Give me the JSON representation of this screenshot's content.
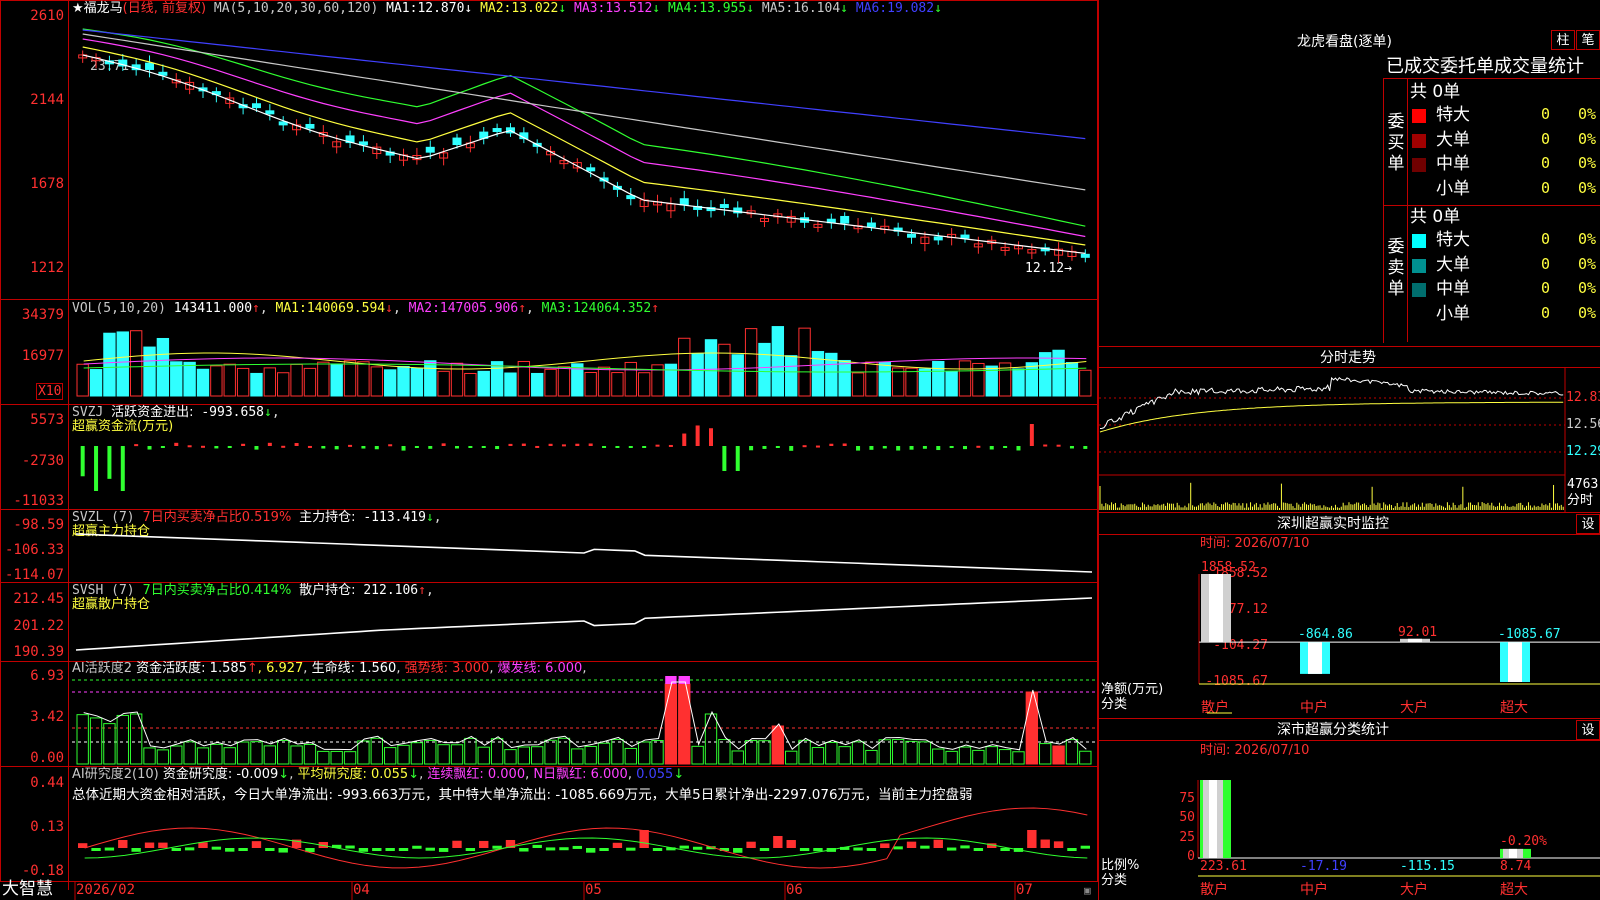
{
  "stock": {
    "star": "★",
    "name": "福龙马",
    "mode": "(日线, 前复权)",
    "ma_header": "MA(5,10,20,30,60,120)",
    "ma": [
      {
        "label": "MA1:",
        "value": "12.870",
        "arrow": "↓"
      },
      {
        "label": "MA2:",
        "value": "13.022",
        "arrow": "↓"
      },
      {
        "label": "MA3:",
        "value": "13.512",
        "arrow": "↓"
      },
      {
        "label": "MA4:",
        "value": "13.955",
        "arrow": "↓"
      },
      {
        "label": "MA5:",
        "value": "16.104",
        "arrow": "↓"
      },
      {
        "label": "MA6:",
        "value": "19.082",
        "arrow": "↓"
      }
    ],
    "high_marker": "23.71",
    "last_marker": "12.12→",
    "y_ticks": [
      "2610",
      "2144",
      "1678",
      "1212"
    ]
  },
  "vol": {
    "header": "VOL(5,10,20)",
    "value": "143411.000",
    "ma": [
      {
        "label": "MA1:",
        "value": "140069.594",
        "arrow": "↓"
      },
      {
        "label": "MA2:",
        "value": "147005.906",
        "arrow": "↑"
      },
      {
        "label": "MA3:",
        "value": "124064.352",
        "arrow": "↑"
      }
    ],
    "y_ticks": [
      "34379",
      "16977"
    ],
    "unit": "X10"
  },
  "svzj": {
    "name": "SVZJ",
    "title": "活跃资金进出:",
    "value": "-993.658",
    "arrow": "↓",
    "subtitle": "超赢资金流(万元)",
    "y_ticks": [
      "5573",
      "-2730",
      "-11033"
    ]
  },
  "svzl": {
    "name": "SVZL (7)",
    "ratio": "7日内买卖净占比0.519%",
    "label": "主力持仓:",
    "value": "-113.419",
    "arrow": "↓",
    "subtitle": "超赢主力持仓",
    "y_ticks": [
      "-98.59",
      "-106.33",
      "-114.07"
    ]
  },
  "svsh": {
    "name": "SVSH (7)",
    "ratio": "7日内买卖净占比0.414%",
    "label": "散户持仓:",
    "value": "212.106",
    "arrow": "↑",
    "subtitle": "超赢散户持仓",
    "y_ticks": [
      "212.45",
      "201.22",
      "190.39"
    ]
  },
  "ai_active": {
    "name": "AI活跃度2",
    "label": "资金活跃度:",
    "value": "1.585",
    "arrow": "↑",
    "value2": "6.927",
    "life_label": "生命线:",
    "life": "1.560",
    "strong": "强势线: 3.000",
    "burst": "爆发线: 6.000",
    "y_ticks": [
      "6.93",
      "3.42",
      "0.00"
    ]
  },
  "ai_research": {
    "name": "AI研究度2(10)",
    "label": "资金研究度:",
    "value": "-0.009",
    "arrow": "↓",
    "avg": "平均研究度: 0.055",
    "avg_arrow": "↓",
    "streak": "连续飘红: 0.000",
    "nday": "N日飘红: 6.000",
    "last": "0.055",
    "summary": "总体近期大资金相对活跃，今日大单净流出: -993.663万元，其中特大单净流出: -1085.669万元，大单5日累计净出-2297.076万元，当前主力控盘弱",
    "y_ticks": [
      "0.44",
      "0.13",
      "-0.18"
    ]
  },
  "footer": {
    "brand": "大智慧",
    "dates": [
      "2026/02",
      "04",
      "05",
      "06",
      "07"
    ]
  },
  "dragon": {
    "title": "龙虎看盘(逐单)",
    "btn1": "柱",
    "btn2": "笔",
    "subtitle": "已成交委托单成交量统计",
    "buy_label": [
      "委",
      "买",
      "单"
    ],
    "sell_label": [
      "委",
      "卖",
      "单"
    ],
    "buy_total": "共 0单",
    "sell_total": "共 0单",
    "buy_rows": [
      {
        "name": "特大",
        "count": "0",
        "pct": "0%",
        "color": "#ff0000"
      },
      {
        "name": "大单",
        "count": "0",
        "pct": "0%",
        "color": "#a00000"
      },
      {
        "name": "中单",
        "count": "0",
        "pct": "0%",
        "color": "#700000"
      },
      {
        "name": "小单",
        "count": "0",
        "pct": "0%",
        "color": "#000000"
      }
    ],
    "sell_rows": [
      {
        "name": "特大",
        "count": "0",
        "pct": "0%",
        "color": "#00ffff"
      },
      {
        "name": "大单",
        "count": "0",
        "pct": "0%",
        "color": "#009090"
      },
      {
        "name": "中单",
        "count": "0",
        "pct": "0%",
        "color": "#006e6e"
      },
      {
        "name": "小单",
        "count": "0",
        "pct": "0%",
        "color": "#000000"
      }
    ]
  },
  "intraday": {
    "title": "分时走势",
    "prices": [
      "12.83",
      "12.56",
      "12.29"
    ],
    "vol": "4763",
    "vol_label": "分时"
  },
  "monitor": {
    "title": "深圳超赢实时监控",
    "btn": "设",
    "time": "时间: 2026/07/10",
    "y_ticks": [
      "1858.52",
      "877.12",
      "-104.27",
      "-1085.67"
    ],
    "ylabel": "净额(万元)",
    "xlabel": "分类",
    "categories": [
      "散户",
      "中户",
      "大户",
      "超大"
    ],
    "values": [
      1858.52,
      -864.86,
      92.01,
      -1085.67
    ],
    "value_labels": [
      "1858.52",
      "-864.86",
      "92.01",
      "-1085.67"
    ]
  },
  "stats": {
    "title": "深市超赢分类统计",
    "btn": "设",
    "time": "时间: 2026/07/10",
    "y_ticks": [
      "75",
      "50",
      "25",
      "0"
    ],
    "ylabel": "比例%",
    "xlabel": "分类",
    "categories": [
      "散户",
      "中户",
      "大户",
      "超大"
    ],
    "values": [
      223.61,
      -17.19,
      -115.15,
      8.74
    ],
    "value_labels": [
      "223.61",
      "-17.19",
      "-115.15",
      "8.74"
    ],
    "extra_label": "-0.20%"
  },
  "chart_data": [
    {
      "type": "bar",
      "title": "深圳超赢实时监控",
      "ylabel": "净额(万元)",
      "xlabel": "分类",
      "categories": [
        "散户",
        "中户",
        "大户",
        "超大"
      ],
      "values": [
        1858.52,
        -864.86,
        92.01,
        -1085.67
      ],
      "ylim": [
        -1085.67,
        1858.52
      ]
    },
    {
      "type": "bar",
      "title": "深市超赢分类统计",
      "ylabel": "比例%",
      "xlabel": "分类",
      "categories": [
        "散户",
        "中户",
        "大户",
        "超大"
      ],
      "values": [
        223.61,
        -17.19,
        -115.15,
        8.74
      ],
      "ylim": [
        0,
        75
      ]
    }
  ]
}
